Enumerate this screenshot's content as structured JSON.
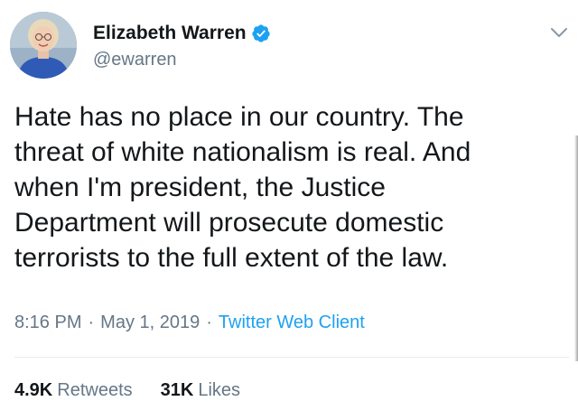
{
  "author": {
    "display_name": "Elizabeth Warren",
    "handle": "@ewarren",
    "verified": true,
    "verified_color": "#1da1f2"
  },
  "tweet": {
    "text": "Hate has no place in our country. The\nthreat of white nationalism is real. And\nwhen I'm president, the Justice\nDepartment will prosecute domestic\nterrorists to the full extent of the law.",
    "time": "8:16 PM",
    "separator": "·",
    "date": "May 1, 2019",
    "client": "Twitter Web Client"
  },
  "stats": {
    "retweets_count": "4.9K",
    "retweets_label": "Retweets",
    "likes_count": "31K",
    "likes_label": "Likes"
  },
  "colors": {
    "text": "#14171a",
    "secondary": "#657786",
    "link": "#1da1f2",
    "divider": "#e6ecf0"
  },
  "icons": {
    "more": "chevron-down-icon",
    "verified": "verified-badge-icon"
  }
}
